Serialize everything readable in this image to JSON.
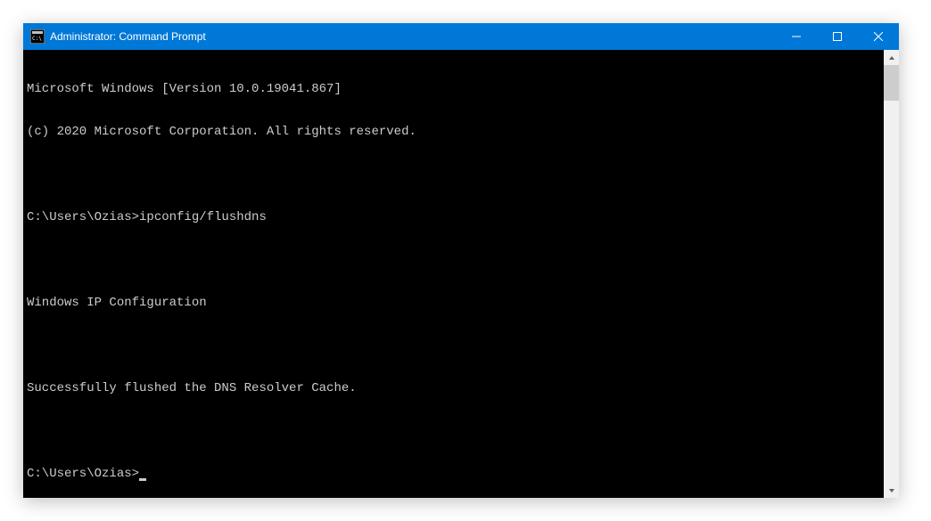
{
  "window": {
    "title": "Administrator: Command Prompt"
  },
  "terminal": {
    "lines": [
      "Microsoft Windows [Version 10.0.19041.867]",
      "(c) 2020 Microsoft Corporation. All rights reserved.",
      "",
      "C:\\Users\\Ozias>ipconfig/flushdns",
      "",
      "Windows IP Configuration",
      "",
      "Successfully flushed the DNS Resolver Cache.",
      ""
    ],
    "current_prompt": "C:\\Users\\Ozias>"
  }
}
